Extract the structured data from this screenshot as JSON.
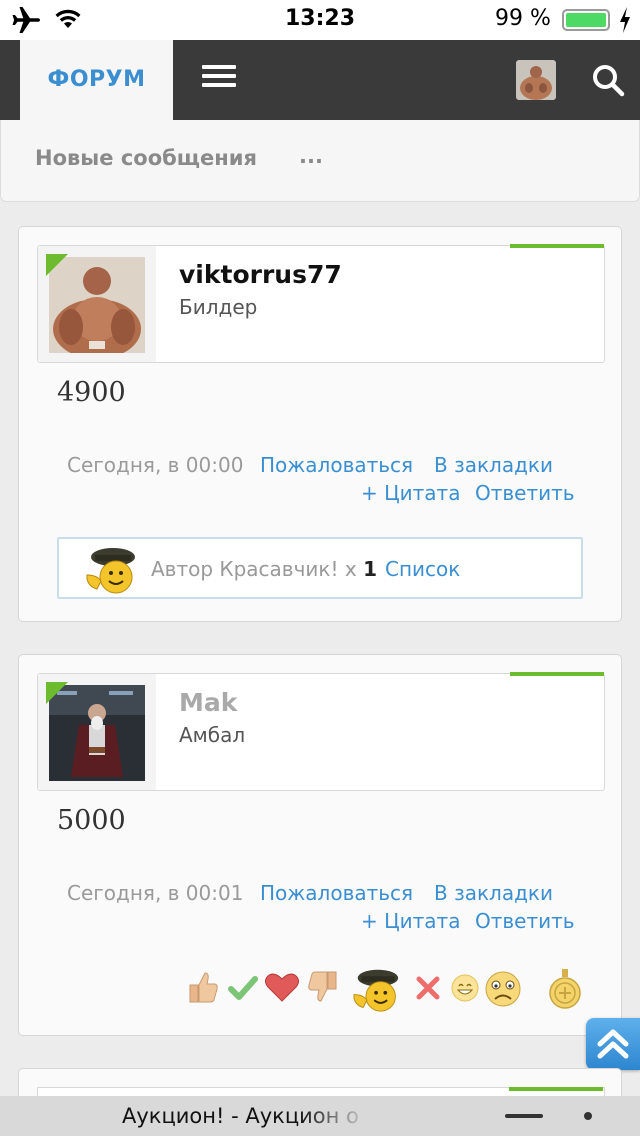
{
  "status_bar": {
    "time": "13:23",
    "battery_percent": "99 %"
  },
  "nav": {
    "forum_tab": "ФОРУМ"
  },
  "subnav": {
    "new_messages": "Новые сообщения",
    "more": "..."
  },
  "posts": [
    {
      "username": "viktorrus77",
      "user_title": "Билдер",
      "text": "4900",
      "date": "Сегодня, в 00:00",
      "report": "Пожаловаться",
      "bookmark": "В закладки",
      "quote": "+ Цитата",
      "reply": "Ответить",
      "likes": {
        "label": "Автор Красавчик! x ",
        "count": "1",
        "list": "Список"
      }
    },
    {
      "username": "Mak",
      "user_title": "Амбал",
      "text": "5000",
      "date": "Сегодня, в 00:01",
      "report": "Пожаловаться",
      "bookmark": "В закладки",
      "quote": "+ Цитата",
      "reply": "Ответить",
      "reactions": [
        "thumbs-up-icon",
        "check-icon",
        "heart-icon",
        "thumbs-down-icon",
        "author-smiley-icon",
        "cross-icon",
        "grin-icon",
        "sad-icon",
        "medal-icon"
      ]
    }
  ],
  "browser_bar": {
    "page_title": "Аукцион! - Аукцион о"
  },
  "colors": {
    "link": "#3b8fd1",
    "online": "#6dbb2f",
    "nav_bg": "#3a3a3a"
  }
}
